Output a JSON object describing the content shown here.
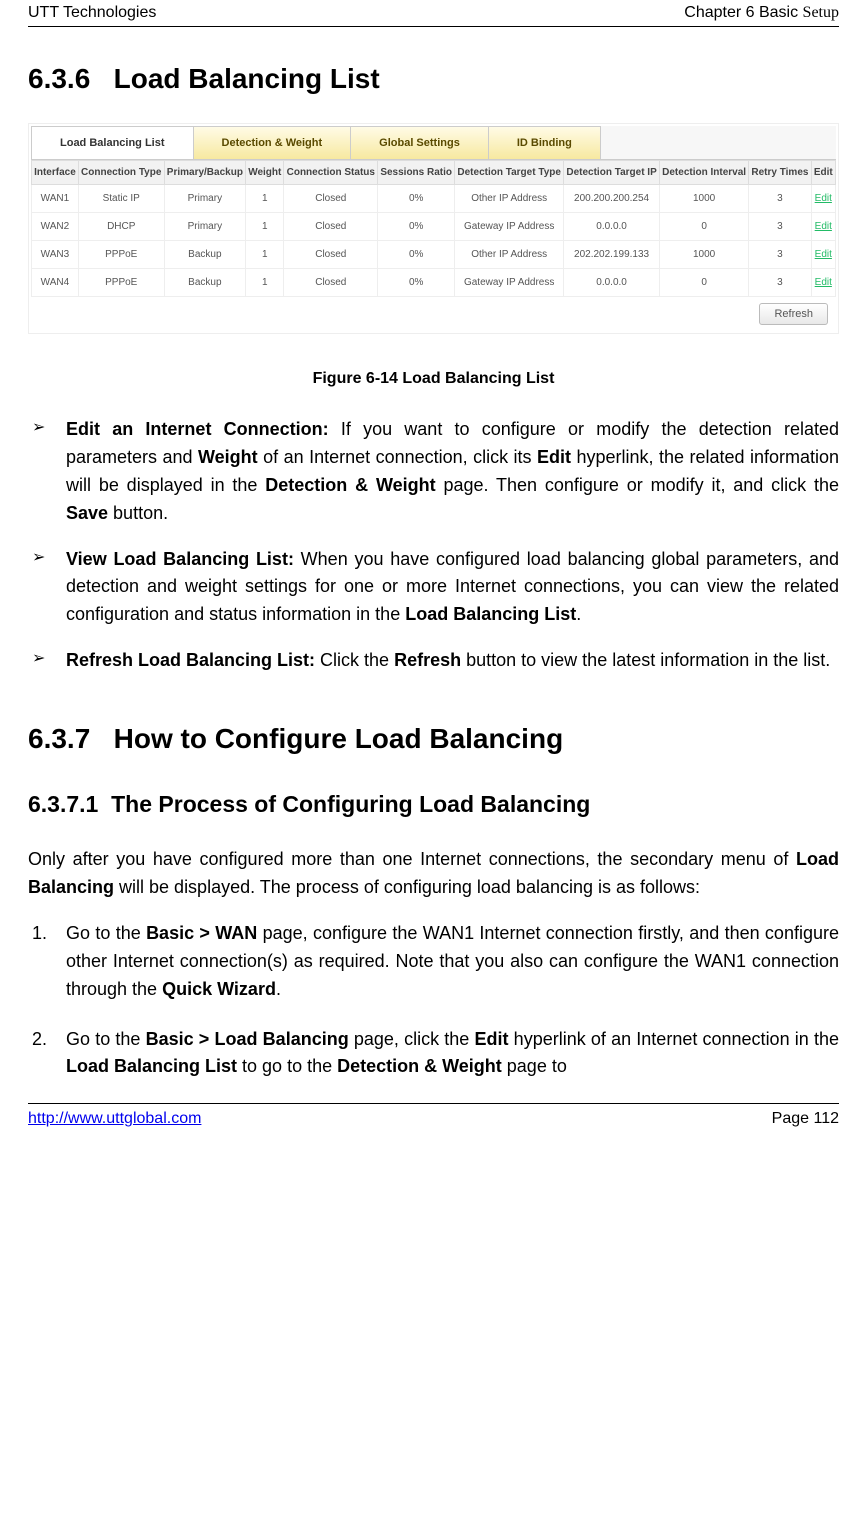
{
  "header": {
    "left": "UTT Technologies",
    "right_plain": "Chapter 6 Basic ",
    "right_serif": "Setup"
  },
  "footer": {
    "link": "http://www.uttglobal.com",
    "page": "Page 112"
  },
  "sections": {
    "s636": {
      "num": "6.3.6",
      "title": "Load Balancing List"
    },
    "s637": {
      "num": "6.3.7",
      "title": "How to Configure Load Balancing"
    },
    "s6371": {
      "num": "6.3.7.1",
      "title": "The Process of Configuring Load Balancing"
    }
  },
  "figure_caption": "Figure 6-14 Load Balancing List",
  "screenshot": {
    "tabs": [
      "Load Balancing List",
      "Detection & Weight",
      "Global Settings",
      "ID Binding"
    ],
    "active_tab": 0,
    "columns": [
      "Interface",
      "Connection Type",
      "Primary/Backup",
      "Weight",
      "Connection Status",
      "Sessions Ratio",
      "Detection Target Type",
      "Detection Target IP",
      "Detection Interval",
      "Retry Times",
      "Edit"
    ],
    "rows": [
      {
        "iface": "WAN1",
        "ctype": "Static IP",
        "pb": "Primary",
        "w": "1",
        "cs": "Closed",
        "sr": "0%",
        "dtt": "Other IP Address",
        "dti": "200.200.200.254",
        "di": "1000",
        "rt": "3",
        "edit": "Edit"
      },
      {
        "iface": "WAN2",
        "ctype": "DHCP",
        "pb": "Primary",
        "w": "1",
        "cs": "Closed",
        "sr": "0%",
        "dtt": "Gateway IP Address",
        "dti": "0.0.0.0",
        "di": "0",
        "rt": "3",
        "edit": "Edit"
      },
      {
        "iface": "WAN3",
        "ctype": "PPPoE",
        "pb": "Backup",
        "w": "1",
        "cs": "Closed",
        "sr": "0%",
        "dtt": "Other IP Address",
        "dti": "202.202.199.133",
        "di": "1000",
        "rt": "3",
        "edit": "Edit"
      },
      {
        "iface": "WAN4",
        "ctype": "PPPoE",
        "pb": "Backup",
        "w": "1",
        "cs": "Closed",
        "sr": "0%",
        "dtt": "Gateway IP Address",
        "dti": "0.0.0.0",
        "di": "0",
        "rt": "3",
        "edit": "Edit"
      }
    ],
    "refresh_label": "Refresh"
  },
  "bullets": {
    "b1": {
      "lead": "Edit an Internet Connection:",
      "t1": " If you want to configure or modify the detection related parameters and ",
      "b2": "Weight",
      "t2": " of an Internet connection, click its ",
      "b3": "Edit",
      "t3": " hyperlink, the related information will be displayed in the ",
      "b4": "Detection & Weight",
      "t4": " page. Then configure or modify it, and click the ",
      "b5": "Save",
      "t5": " button."
    },
    "b2": {
      "lead": "View Load Balancing List:",
      "t1": " When you have configured load balancing global parameters, and detection and weight settings for one or more Internet connections, you can view the related configuration and status information in the ",
      "b2": "Load Balancing List",
      "t2": "."
    },
    "b3": {
      "lead": "Refresh Load Balancing List:",
      "t1": " Click the ",
      "b2": "Refresh",
      "t2": " button to view the latest information in the list."
    }
  },
  "para_process": {
    "t1": "Only after you have configured more than one Internet connections, the secondary menu of ",
    "b1": "Load Balancing",
    "t2": " will be displayed. The process of configuring load balancing is as follows:"
  },
  "steps": {
    "s1": {
      "num": "1.",
      "t1": "Go to the ",
      "b1": "Basic > WAN",
      "t2": " page, configure the WAN1 Internet connection firstly, and then configure other Internet connection(s) as required. Note that you also can configure the WAN1 connection through the ",
      "b2": "Quick Wizard",
      "t3": "."
    },
    "s2": {
      "num": "2.",
      "t1": "Go to the ",
      "b1": "Basic > Load Balancing",
      "t2": " page, click the ",
      "b2": "Edit",
      "t3": " hyperlink of an Internet connection in the ",
      "b3": "Load Balancing List",
      "t4": " to go to the ",
      "b4": "Detection & Weight",
      "t5": " page to"
    }
  }
}
